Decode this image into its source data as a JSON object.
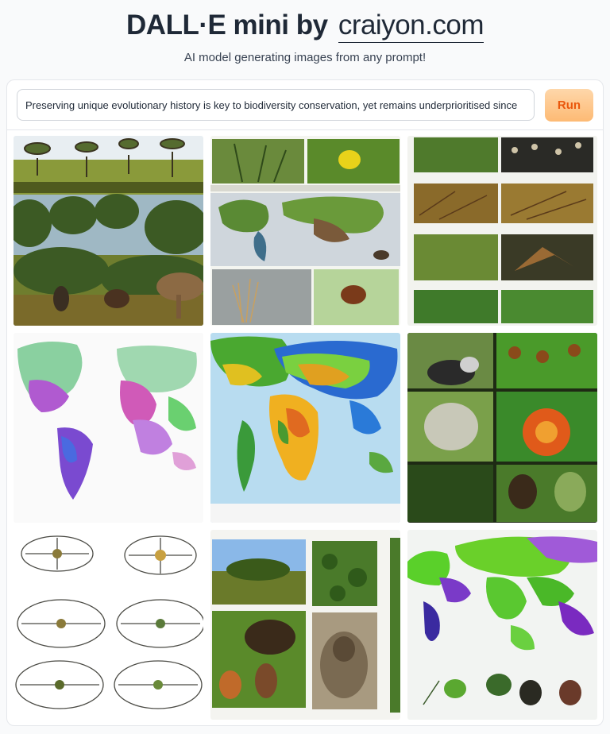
{
  "header": {
    "title_bold": "DALL·E mini by",
    "title_link": "craiyon.com",
    "subtitle": "AI model generating images from any prompt!"
  },
  "prompt": {
    "value": "Preserving unique evolutionary history is key to biodiversity conservation, yet remains underprioritised since"
  },
  "run_button": {
    "label": "Run"
  },
  "results": {
    "tiles": [
      {
        "icon": "savanna-trees-and-animals-image"
      },
      {
        "icon": "plant-collage-world-map-image"
      },
      {
        "icon": "grass-plant-grid-collage-image"
      },
      {
        "icon": "colorful-world-map-image"
      },
      {
        "icon": "heatmap-world-map-image"
      },
      {
        "icon": "green-plants-and-flower-collage-image"
      },
      {
        "icon": "flower-sketch-diagram-image"
      },
      {
        "icon": "wildlife-photo-collage-image"
      },
      {
        "icon": "green-world-map-with-plants-image"
      }
    ]
  }
}
